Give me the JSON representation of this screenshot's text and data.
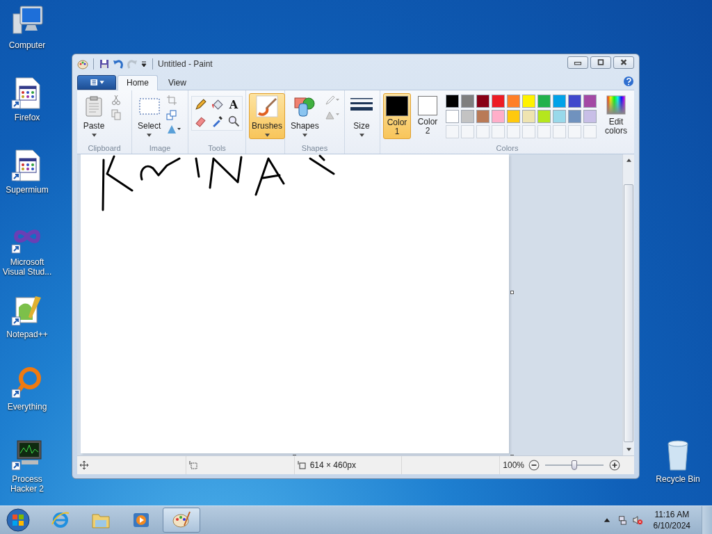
{
  "desktop_icons": [
    {
      "kind": "computer",
      "label": "Computer"
    },
    {
      "kind": "program",
      "label": "Firefox"
    },
    {
      "kind": "program",
      "label": "Supermium"
    },
    {
      "kind": "infinity",
      "label": "Microsoft Visual Stud..."
    },
    {
      "kind": "notepad",
      "label": "Notepad++"
    },
    {
      "kind": "ring",
      "label": "Everything"
    },
    {
      "kind": "monitor",
      "label": "Process Hacker 2"
    }
  ],
  "recycle_bin": {
    "label": "Recycle Bin"
  },
  "window": {
    "title": "Untitled - Paint"
  },
  "tabs": [
    {
      "label": "Home",
      "selected": true
    },
    {
      "label": "View",
      "selected": false
    }
  ],
  "ribbon": {
    "groups": [
      {
        "kind": "clipboard",
        "label": "Clipboard"
      },
      {
        "kind": "image",
        "label": "Image"
      },
      {
        "kind": "tools",
        "label": "Tools"
      },
      {
        "kind": "brushes"
      },
      {
        "kind": "shapes",
        "label": "Shapes"
      },
      {
        "kind": "size"
      },
      {
        "kind": "colors",
        "label": "Colors"
      }
    ],
    "paste_label": "Paste",
    "select_label": "Select",
    "tools": [
      {
        "kind": "pencil"
      },
      {
        "kind": "fill"
      },
      {
        "kind": "text",
        "glyph": "A"
      },
      {
        "kind": "eraser"
      },
      {
        "kind": "picker"
      },
      {
        "kind": "magnifier"
      }
    ],
    "brushes": {
      "label": "Brushes",
      "selected": true
    },
    "shapes_label": "Shapes",
    "size_label": "Size",
    "color_slots": [
      {
        "label": "Color 1",
        "color": "#000000",
        "selected": true
      },
      {
        "label": "Color 2",
        "color": "#ffffff",
        "selected": false
      }
    ],
    "palette": [
      {
        "color": "#000000"
      },
      {
        "color": "#7f7f7f"
      },
      {
        "color": "#880015"
      },
      {
        "color": "#ed1c24"
      },
      {
        "color": "#ff7f27"
      },
      {
        "color": "#fff200"
      },
      {
        "color": "#22b14c"
      },
      {
        "color": "#00a2e8"
      },
      {
        "color": "#3f48cc"
      },
      {
        "color": "#a349a4"
      },
      {
        "color": "#ffffff"
      },
      {
        "color": "#c3c3c3"
      },
      {
        "color": "#b97a57"
      },
      {
        "color": "#ffaec9"
      },
      {
        "color": "#ffc90e"
      },
      {
        "color": "#efe4b0"
      },
      {
        "color": "#b5e61d"
      },
      {
        "color": "#99d9ea"
      },
      {
        "color": "#7092be"
      },
      {
        "color": "#c8bfe7"
      }
    ],
    "edit_colors_label": "Edit colors"
  },
  "status_bar": {
    "canvas_size": "614 × 460px",
    "zoom": {
      "label": "100%",
      "level": 0.5
    }
  },
  "taskbar": {
    "items": [
      {
        "kind": "browser",
        "selected": false
      },
      {
        "kind": "folder",
        "selected": false
      },
      {
        "kind": "player",
        "selected": false
      },
      {
        "kind": "paint",
        "selected": true
      }
    ],
    "time": "11:16 AM",
    "date": "6/10/2024"
  }
}
